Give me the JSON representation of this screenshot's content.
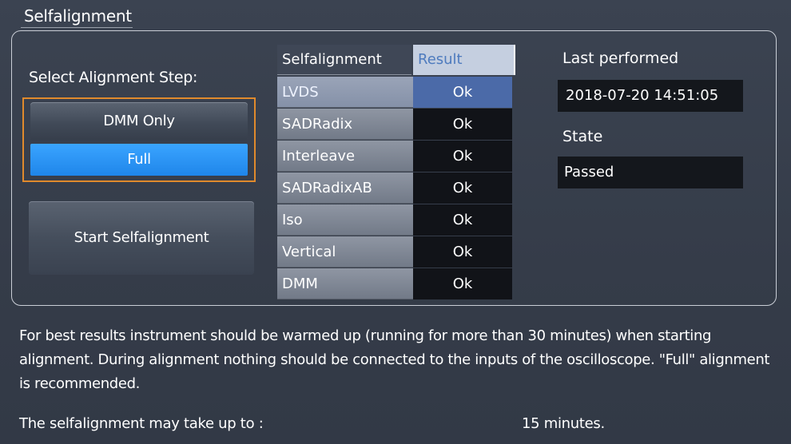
{
  "dialog": {
    "title": "Selfalignment"
  },
  "select": {
    "label": "Select Alignment Step:",
    "options": [
      "DMM Only",
      "Full"
    ],
    "selected": "Full"
  },
  "start_button": "Start Selfalignment",
  "table": {
    "headers": [
      "Selfalignment",
      "Result"
    ],
    "rows": [
      {
        "name": "LVDS",
        "result": "Ok"
      },
      {
        "name": "SADRadix",
        "result": "Ok"
      },
      {
        "name": "Interleave",
        "result": "Ok"
      },
      {
        "name": "SADRadixAB",
        "result": "Ok"
      },
      {
        "name": "Iso",
        "result": "Ok"
      },
      {
        "name": "Vertical",
        "result": "Ok"
      },
      {
        "name": "DMM",
        "result": "Ok"
      }
    ]
  },
  "last_performed": {
    "label": "Last performed",
    "value": "2018-07-20 14:51:05"
  },
  "state": {
    "label": "State",
    "value": "Passed"
  },
  "info_text": "For best results instrument should be warmed up (running for more than 30 minutes) when starting alignment. During alignment nothing should be connected to the inputs of the oscilloscope. \"Full\" alignment is recommended.",
  "duration": {
    "label": "The selfalignment may take up to :",
    "value": "15 minutes."
  },
  "colors": {
    "selected_blue": "#1f86ea",
    "focus_orange": "#e08a2c"
  }
}
